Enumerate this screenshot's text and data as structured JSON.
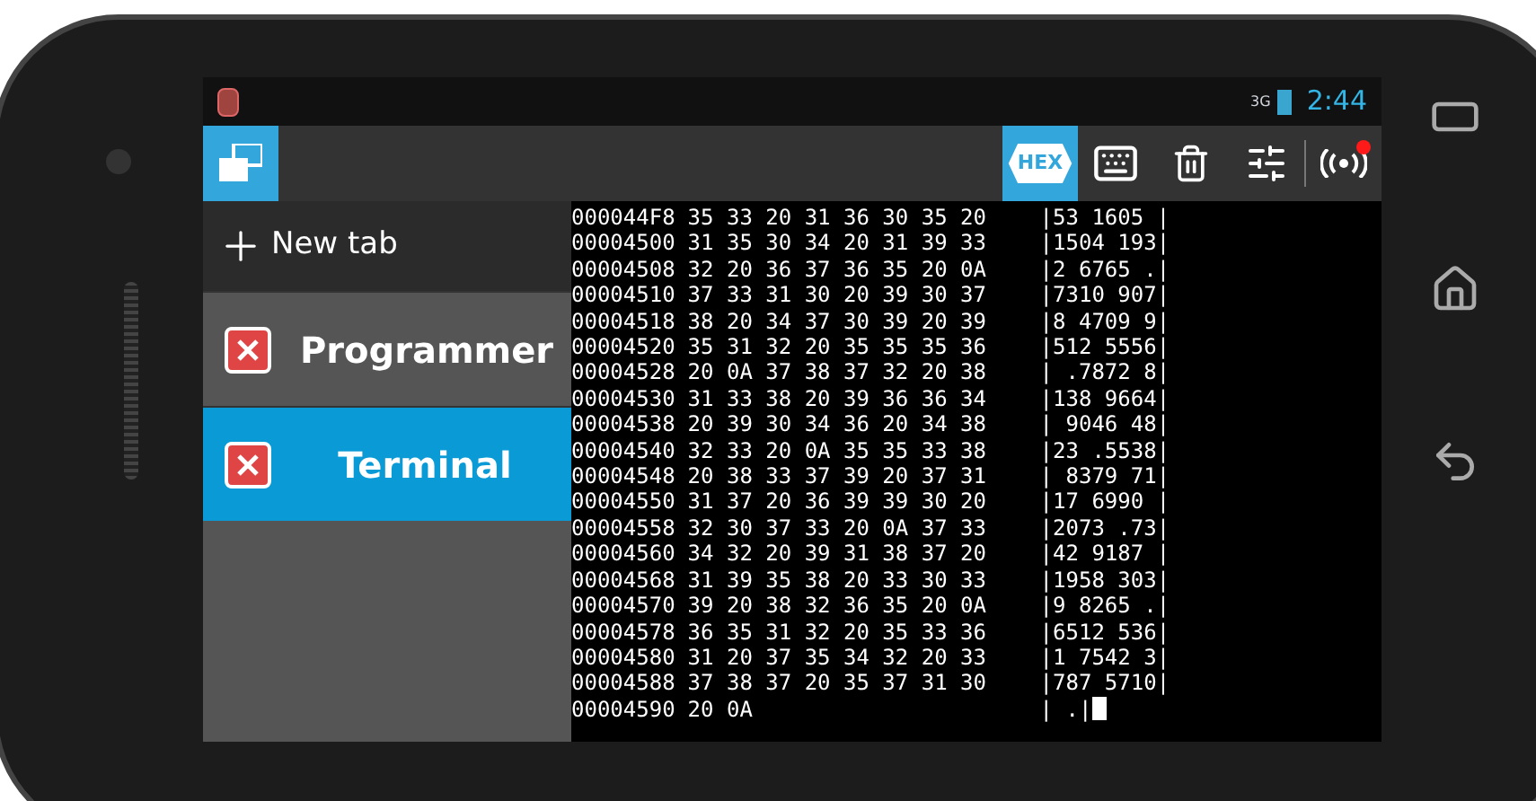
{
  "status_bar": {
    "network": "3G",
    "time": "2:44"
  },
  "action_bar": {
    "hex_button": {
      "label": "HEX",
      "on": true
    },
    "connection": {
      "alert": true
    }
  },
  "sidebar": {
    "new_tab": "New tab",
    "tabs": [
      {
        "label": "Programmer",
        "selected": false
      },
      {
        "label": "Terminal",
        "selected": true
      }
    ]
  },
  "terminal": {
    "rows": [
      {
        "address": "000044F8",
        "bytes": "35 33 20 31 36 30 35 20",
        "ascii": "|53 1605 |"
      },
      {
        "address": "00004500",
        "bytes": "31 35 30 34 20 31 39 33",
        "ascii": "|1504 193|"
      },
      {
        "address": "00004508",
        "bytes": "32 20 36 37 36 35 20 0A",
        "ascii": "|2 6765 .|"
      },
      {
        "address": "00004510",
        "bytes": "37 33 31 30 20 39 30 37",
        "ascii": "|7310 907|"
      },
      {
        "address": "00004518",
        "bytes": "38 20 34 37 30 39 20 39",
        "ascii": "|8 4709 9|"
      },
      {
        "address": "00004520",
        "bytes": "35 31 32 20 35 35 35 36",
        "ascii": "|512 5556|"
      },
      {
        "address": "00004528",
        "bytes": "20 0A 37 38 37 32 20 38",
        "ascii": "| .7872 8|"
      },
      {
        "address": "00004530",
        "bytes": "31 33 38 20 39 36 36 34",
        "ascii": "|138 9664|"
      },
      {
        "address": "00004538",
        "bytes": "20 39 30 34 36 20 34 38",
        "ascii": "| 9046 48|"
      },
      {
        "address": "00004540",
        "bytes": "32 33 20 0A 35 35 33 38",
        "ascii": "|23 .5538|"
      },
      {
        "address": "00004548",
        "bytes": "20 38 33 37 39 20 37 31",
        "ascii": "| 8379 71|"
      },
      {
        "address": "00004550",
        "bytes": "31 37 20 36 39 39 30 20",
        "ascii": "|17 6990 |"
      },
      {
        "address": "00004558",
        "bytes": "32 30 37 33 20 0A 37 33",
        "ascii": "|2073 .73|"
      },
      {
        "address": "00004560",
        "bytes": "34 32 20 39 31 38 37 20",
        "ascii": "|42 9187 |"
      },
      {
        "address": "00004568",
        "bytes": "31 39 35 38 20 33 30 33",
        "ascii": "|1958 303|"
      },
      {
        "address": "00004570",
        "bytes": "39 20 38 32 36 35 20 0A",
        "ascii": "|9 8265 .|"
      },
      {
        "address": "00004578",
        "bytes": "36 35 31 32 20 35 33 36",
        "ascii": "|6512 536|"
      },
      {
        "address": "00004580",
        "bytes": "31 20 37 35 34 32 20 33",
        "ascii": "|1 7542 3|"
      },
      {
        "address": "00004588",
        "bytes": "37 38 37 20 35 37 31 30",
        "ascii": "|787 5710|"
      },
      {
        "address": "00004590",
        "bytes": "20 0A",
        "ascii": "| .|"
      }
    ],
    "cursor": true
  }
}
